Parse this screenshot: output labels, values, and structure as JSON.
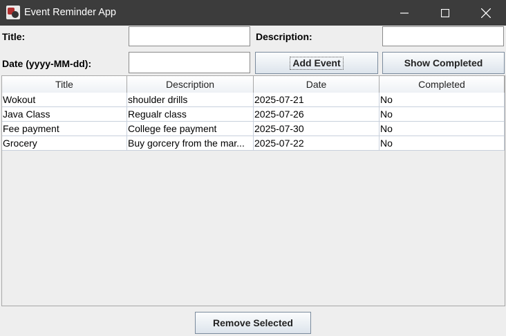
{
  "window": {
    "title": "Event Reminder App",
    "icon": "app-icon"
  },
  "form": {
    "title_label": "Title:",
    "title_value": "",
    "description_label": "Description:",
    "description_value": "",
    "date_label": "Date (yyyy-MM-dd):",
    "date_value": ""
  },
  "buttons": {
    "add_event": "Add Event",
    "show_completed": "Show Completed",
    "remove_selected": "Remove Selected"
  },
  "table": {
    "columns": [
      "Title",
      "Description",
      "Date",
      "Completed"
    ],
    "rows": [
      [
        "Wokout",
        "shoulder drills",
        "2025-07-21",
        "No"
      ],
      [
        "Java Class",
        "Regualr class",
        "2025-07-26",
        "No"
      ],
      [
        "Fee payment",
        "College fee payment",
        "2025-07-30",
        "No"
      ],
      [
        "Grocery",
        "Buy gorcery from the mar...",
        "2025-07-22",
        "No"
      ]
    ]
  },
  "colors": {
    "titlebar": "#3c3c3c",
    "background": "#eeeeee",
    "button_border": "#7a8a9c"
  }
}
